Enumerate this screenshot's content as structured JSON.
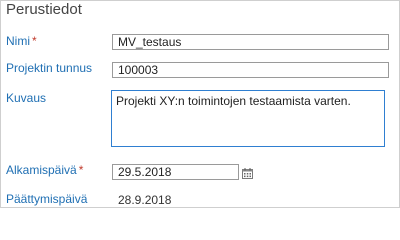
{
  "section": {
    "title": "Perustiedot"
  },
  "fields": {
    "nimi": {
      "label": "Nimi",
      "required_mark": "*",
      "value": "MV_testaus"
    },
    "projektin_tunnus": {
      "label": "Projektin tunnus",
      "value": "100003"
    },
    "kuvaus": {
      "label": "Kuvaus",
      "value": "Projekti XY:n toimintojen testaamista varten."
    },
    "alkamispaiva": {
      "label": "Alkamispäivä",
      "required_mark": "*",
      "value": "29.5.2018",
      "icon": "calendar-icon"
    },
    "paattymispaiva": {
      "label": "Päättymispäivä",
      "value": "28.9.2018"
    }
  },
  "colors": {
    "label": "#1f6fb3",
    "required": "#c0392b",
    "focus_border": "#2f7fd1",
    "border": "#9a9a9a"
  }
}
